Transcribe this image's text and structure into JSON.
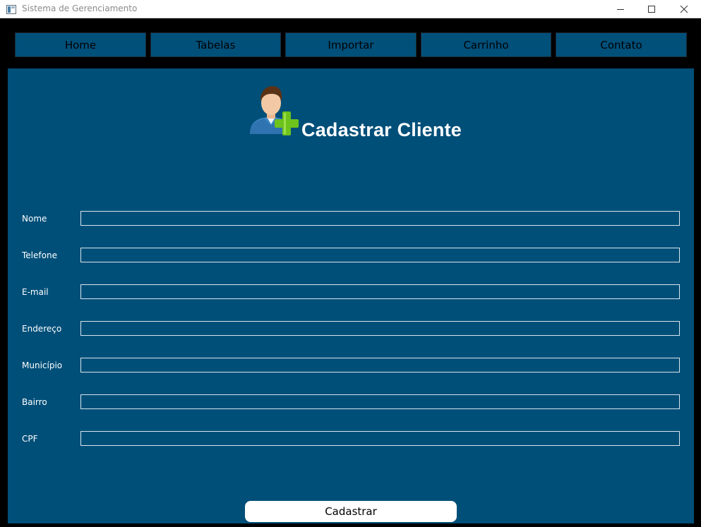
{
  "window": {
    "title": "Sistema de Gerenciamento"
  },
  "nav": {
    "items": [
      {
        "label": "Home"
      },
      {
        "label": "Tabelas"
      },
      {
        "label": "Importar"
      },
      {
        "label": "Carrinho"
      },
      {
        "label": "Contato"
      }
    ]
  },
  "form": {
    "icon": "user-add-icon",
    "title": "Cadastrar Cliente",
    "fields": [
      {
        "label": "Nome",
        "value": ""
      },
      {
        "label": "Telefone",
        "value": ""
      },
      {
        "label": "E-mail",
        "value": ""
      },
      {
        "label": "Endereço",
        "value": ""
      },
      {
        "label": "Município",
        "value": ""
      },
      {
        "label": "Bairro",
        "value": ""
      },
      {
        "label": "CPF",
        "value": ""
      }
    ],
    "submit_label": "Cadastrar"
  },
  "colors": {
    "panel": "#004f79",
    "nav_button": "#00507a",
    "background": "#000000",
    "text": "#ffffff"
  }
}
